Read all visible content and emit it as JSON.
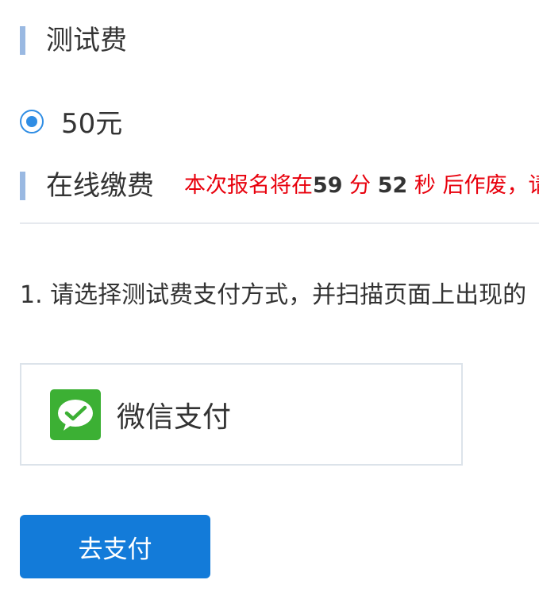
{
  "fee_section": {
    "title": "测试费"
  },
  "fee_option": {
    "label": "50元",
    "selected": true
  },
  "online_section": {
    "title": "在线缴费"
  },
  "countdown": {
    "prefix": "本次报名将在",
    "minutes": "59",
    "minutes_unit": " 分 ",
    "seconds": "52",
    "seconds_unit": " 秒 后作废，请"
  },
  "instruction": {
    "text": "1. 请选择测试费支付方式，并扫描页面上出现的"
  },
  "payment_method": {
    "label": "微信支付",
    "icon": "wechat-pay-icon",
    "icon_color": "#3cb034"
  },
  "pay_button": {
    "label": "去支付",
    "color": "#137bd9"
  },
  "colors": {
    "accent_bar": "#9ab9e2",
    "radio": "#2f8de4",
    "warning": "#e8000c"
  }
}
